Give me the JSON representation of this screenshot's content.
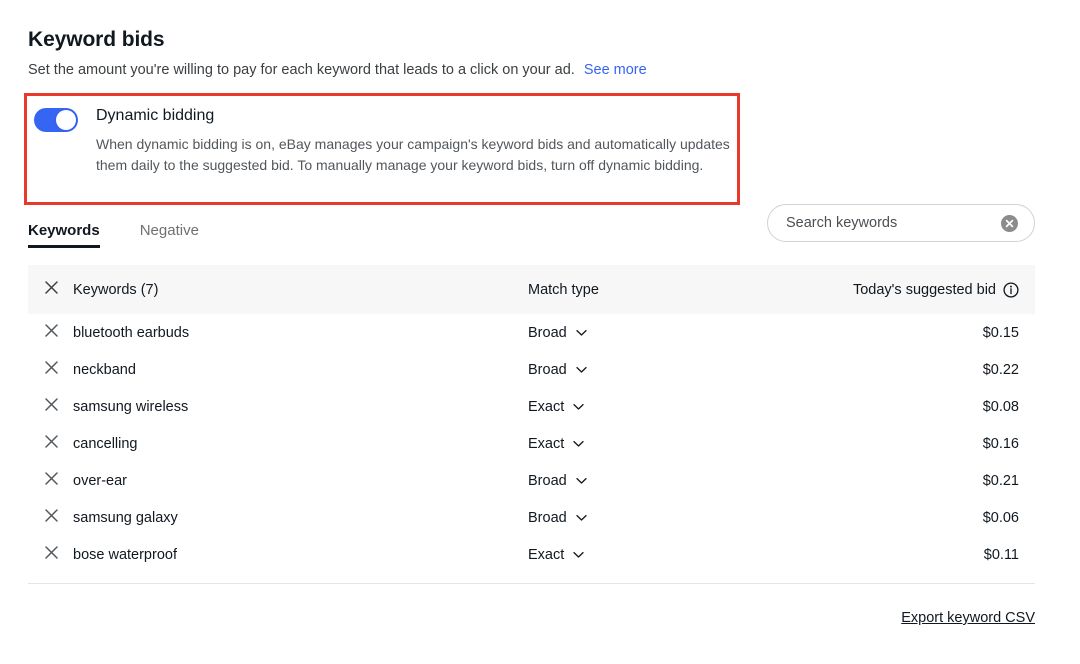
{
  "section": {
    "title": "Keyword bids",
    "subtitle": "Set the amount you're willing to pay for each keyword that leads to a click on your ad.",
    "see_more_label": "See more"
  },
  "dynamic_bidding": {
    "label": "Dynamic bidding",
    "description": "When dynamic bidding is on, eBay manages your campaign's keyword bids and automatically updates them daily to the suggested bid. To manually manage your keyword bids, turn off dynamic bidding.",
    "toggle_state": "on",
    "toggle_color": "#3665f3",
    "highlight_color": "#e8392b"
  },
  "tabs": [
    {
      "label": "Keywords",
      "active": true
    },
    {
      "label": "Negative",
      "active": false
    }
  ],
  "search": {
    "placeholder": "Search keywords",
    "value": "",
    "clear_icon": "clear-circle-icon"
  },
  "table": {
    "headers": {
      "keywords": "Keywords (7)",
      "match_type": "Match type",
      "suggested_bid": "Today's suggested bid"
    },
    "info_icon": "info-circle-icon",
    "remove_icon": "close-x-icon",
    "rows": [
      {
        "keyword": "bluetooth earbuds",
        "match_type": "Broad",
        "bid": "$0.15"
      },
      {
        "keyword": "neckband",
        "match_type": "Broad",
        "bid": "$0.22"
      },
      {
        "keyword": "samsung wireless",
        "match_type": "Exact",
        "bid": "$0.08"
      },
      {
        "keyword": "cancelling",
        "match_type": "Exact",
        "bid": "$0.16"
      },
      {
        "keyword": "over-ear",
        "match_type": "Broad",
        "bid": "$0.21"
      },
      {
        "keyword": "samsung galaxy",
        "match_type": "Broad",
        "bid": "$0.06"
      },
      {
        "keyword": "bose waterproof",
        "match_type": "Exact",
        "bid": "$0.11"
      }
    ]
  },
  "footer": {
    "export_label": "Export keyword CSV"
  },
  "colors": {
    "link_blue": "#3665f3",
    "text_primary": "#111820",
    "text_secondary": "#52575c",
    "header_bg": "#f7f7f7"
  }
}
